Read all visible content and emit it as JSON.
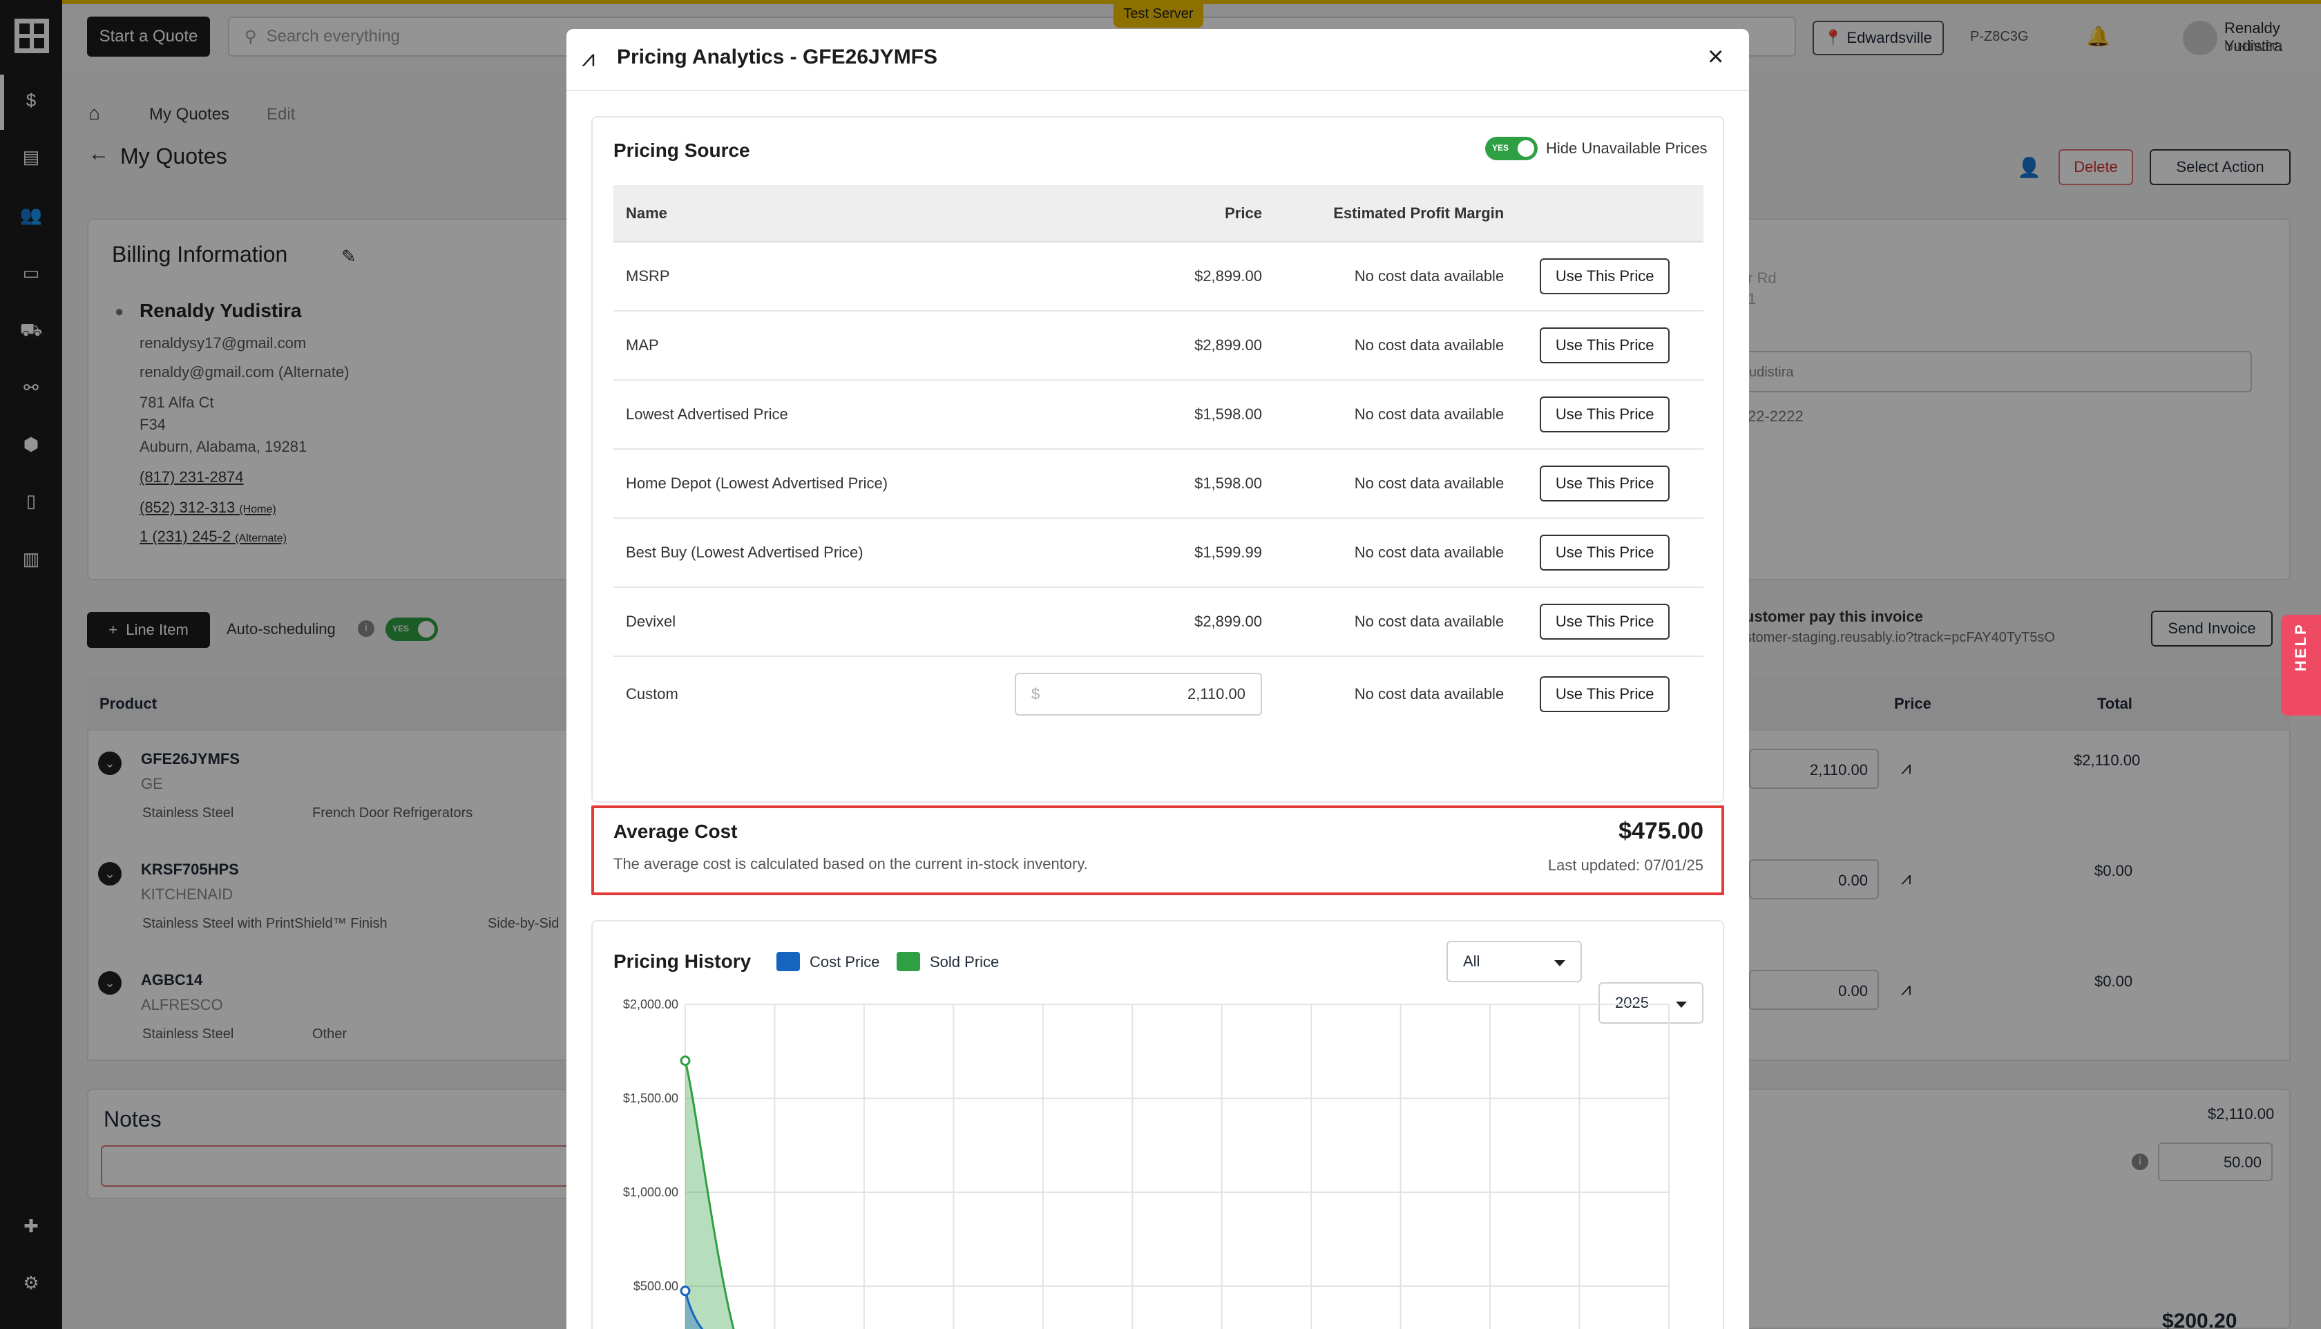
{
  "topbar": {
    "start_quote": "Start a Quote",
    "search_placeholder": "Search everything",
    "test_server": "Test Server",
    "location": "Edwardsville",
    "code": "P-Z8C3G",
    "notifications_count": "0",
    "user_name": "Renaldy Yudistira",
    "user_id": "U-H1W5O"
  },
  "page": {
    "breadcrumb_my_quotes": "My Quotes",
    "breadcrumb_edit": "Edit",
    "title": "My Quotes",
    "delete": "Delete",
    "select_action": "Select Action",
    "billing_title": "Billing Information",
    "customer_name": "Renaldy Yudistira",
    "email": "renaldysy17@gmail.com",
    "email_alt": "renaldy@gmail.com (Alternate)",
    "address_line1": "781 Alfa Ct",
    "address_line2": "F34",
    "address_line3": "Auburn, Alabama, 19281",
    "phone_mobile": "(817) 231-2874",
    "phone_home": "(852) 312-313",
    "phone_home_tag": "(Home)",
    "phone_alt": "1 (231) 245-2",
    "phone_alt_tag": "(Alternate)",
    "right_addr_frag1": "r Rd",
    "right_addr_frag2": "1",
    "right_select_frag": "udistira",
    "right_phone_frag": "22-2222",
    "line_item": "Line Item",
    "auto_scheduling": "Auto-scheduling",
    "pay_invoice_label": "ustomer pay this invoice",
    "pay_invoice_link": "stomer-staging.reusably.io?track=pcFAY40TyT5sO",
    "send_invoice": "Send Invoice",
    "col_product": "Product",
    "col_price": "Price",
    "col_total": "Total",
    "products": [
      {
        "sku": "GFE26JYMFS",
        "brand": "GE",
        "finish": "Stainless Steel",
        "category": "French Door Refrigerators",
        "price": "2,110.00",
        "total": "$2,110.00"
      },
      {
        "sku": "KRSF705HPS",
        "brand": "KITCHENAID",
        "finish": "Stainless Steel with PrintShield™ Finish",
        "category": "Side-by-Sid",
        "price": "0.00",
        "total": "$0.00"
      },
      {
        "sku": "AGBC14",
        "brand": "ALFRESCO",
        "finish": "Stainless Steel",
        "category": "Other",
        "price": "0.00",
        "total": "$0.00"
      }
    ],
    "notes_title": "Notes",
    "summary_total": "$2,110.00",
    "summary_fee": "50.00",
    "summary_bottom": "$200.20",
    "help": "HELP"
  },
  "modal": {
    "title": "Pricing Analytics - GFE26JYMFS",
    "pricing_source_title": "Pricing Source",
    "hide_unavailable_label": "Hide Unavailable Prices",
    "toggle_yes": "YES",
    "col_name": "Name",
    "col_price": "Price",
    "col_margin": "Estimated Profit Margin",
    "use_price": "Use This Price",
    "rows": [
      {
        "name": "MSRP",
        "price": "$2,899.00",
        "margin": "No cost data available"
      },
      {
        "name": "MAP",
        "price": "$2,899.00",
        "margin": "No cost data available"
      },
      {
        "name": "Lowest Advertised Price",
        "price": "$1,598.00",
        "margin": "No cost data available"
      },
      {
        "name": "Home Depot (Lowest Advertised Price)",
        "price": "$1,598.00",
        "margin": "No cost data available"
      },
      {
        "name": "Best Buy (Lowest Advertised Price)",
        "price": "$1,599.99",
        "margin": "No cost data available"
      },
      {
        "name": "Devixel",
        "price": "$2,899.00",
        "margin": "No cost data available"
      }
    ],
    "custom": {
      "name": "Custom",
      "currency": "$",
      "value": "2,110.00",
      "margin": "No cost data available"
    },
    "average_cost": {
      "title": "Average Cost",
      "value": "$475.00",
      "description": "The average cost is calculated based on the current in-stock inventory.",
      "last_updated": "Last updated: 07/01/25"
    },
    "history": {
      "title": "Pricing History",
      "filter": "All",
      "year": "2025"
    }
  },
  "colors": {
    "accent_yellow": "#f2c200",
    "sidebar": "#1c1c1c",
    "toggle_green": "#2ea043",
    "cost_series": "#1565c0",
    "sold_series": "#2ea043",
    "highlight_red": "#e53935"
  },
  "chart_data": {
    "type": "area",
    "title": "Pricing History",
    "series": [
      {
        "name": "Cost Price",
        "color": "#1565c0",
        "values": [
          475,
          0
        ]
      },
      {
        "name": "Sold Price",
        "color": "#2ea043",
        "values": [
          1700,
          0
        ]
      }
    ],
    "x": [
      0,
      1
    ],
    "ylim": [
      0,
      2000
    ],
    "yticks": [
      500,
      1000,
      1500,
      2000
    ],
    "ytick_labels": [
      "$500.00",
      "$1,000.00",
      "$1,500.00",
      "$2,000.00"
    ],
    "grid": true,
    "legend": "top-left"
  }
}
